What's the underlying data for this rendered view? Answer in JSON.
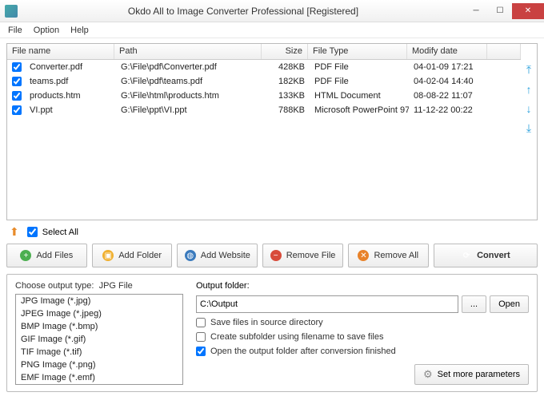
{
  "window": {
    "title": "Okdo All to Image Converter Professional [Registered]"
  },
  "menu": {
    "file": "File",
    "option": "Option",
    "help": "Help"
  },
  "columns": {
    "name": "File name",
    "path": "Path",
    "size": "Size",
    "type": "File Type",
    "date": "Modify date"
  },
  "files": [
    {
      "name": "Converter.pdf",
      "path": "G:\\File\\pdf\\Converter.pdf",
      "size": "428KB",
      "type": "PDF File",
      "date": "04-01-09 17:21"
    },
    {
      "name": "teams.pdf",
      "path": "G:\\File\\pdf\\teams.pdf",
      "size": "182KB",
      "type": "PDF File",
      "date": "04-02-04 14:40"
    },
    {
      "name": "products.htm",
      "path": "G:\\File\\html\\products.htm",
      "size": "133KB",
      "type": "HTML Document",
      "date": "08-08-22 11:07"
    },
    {
      "name": "VI.ppt",
      "path": "G:\\File\\ppt\\VI.ppt",
      "size": "788KB",
      "type": "Microsoft PowerPoint 97...",
      "date": "11-12-22 00:22"
    }
  ],
  "selectAll": "Select All",
  "buttons": {
    "addFiles": "Add Files",
    "addFolder": "Add Folder",
    "addWebsite": "Add Website",
    "removeFile": "Remove File",
    "removeAll": "Remove All",
    "convert": "Convert"
  },
  "outputType": {
    "label": "Choose output type:",
    "current": "JPG File",
    "options": [
      "JPG Image (*.jpg)",
      "JPEG Image (*.jpeg)",
      "BMP Image (*.bmp)",
      "GIF Image (*.gif)",
      "TIF Image (*.tif)",
      "PNG Image (*.png)",
      "EMF Image (*.emf)"
    ]
  },
  "output": {
    "label": "Output folder:",
    "path": "C:\\Output",
    "browse": "...",
    "open": "Open",
    "saveSource": "Save files in source directory",
    "subfolder": "Create subfolder using filename to save files",
    "openAfter": "Open the output folder after conversion finished",
    "openAfterChecked": true,
    "more": "Set more parameters"
  }
}
